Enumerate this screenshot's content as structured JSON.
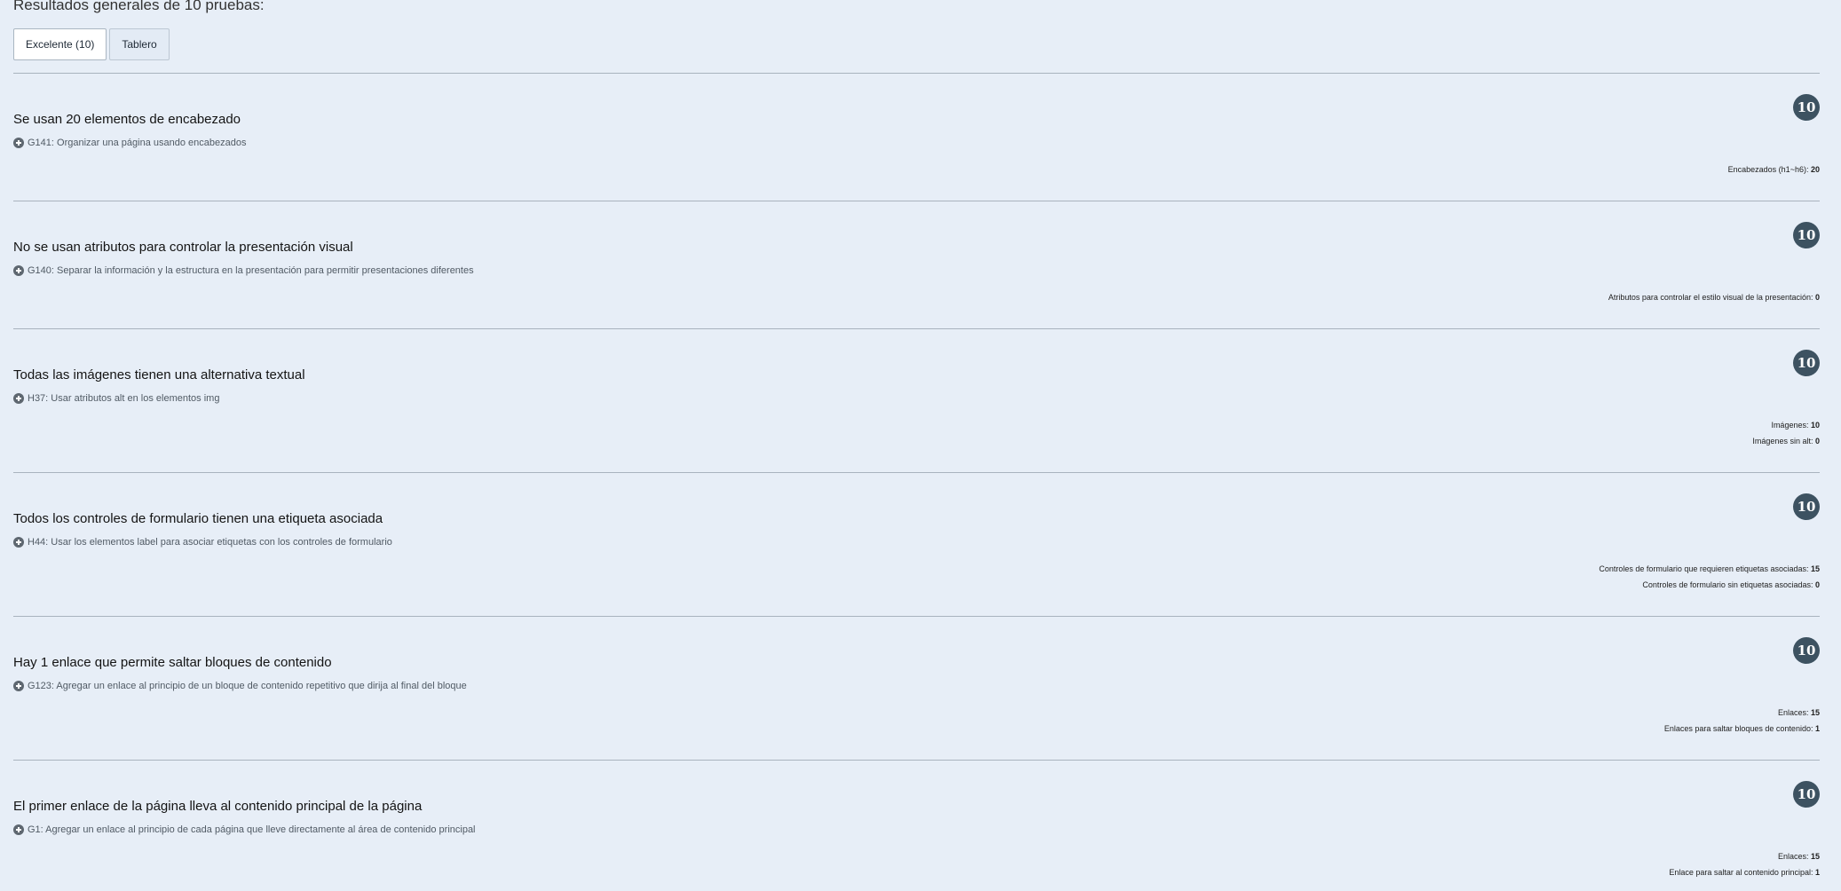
{
  "heading": "Resultados generales de 10 pruebas:",
  "tabs": [
    {
      "label": "Excelente (10)",
      "active": true
    },
    {
      "label": "Tablero",
      "active": false
    }
  ],
  "tests": [
    {
      "title": "Se usan 20 elementos de encabezado",
      "technique": "G141: Organizar una página usando encabezados",
      "score": "10",
      "metrics": [
        {
          "label": "Encabezados (h1~h6):",
          "value": "20"
        }
      ]
    },
    {
      "title": "No se usan atributos para controlar la presentación visual",
      "technique": "G140: Separar la información y la estructura en la presentación para permitir presentaciones diferentes",
      "score": "10",
      "metrics": [
        {
          "label": "Atributos para controlar el estilo visual de la presentación:",
          "value": "0"
        }
      ]
    },
    {
      "title": "Todas las imágenes tienen una alternativa textual",
      "technique": "H37: Usar atributos alt en los elementos img",
      "score": "10",
      "metrics": [
        {
          "label": "Imágenes:",
          "value": "10"
        },
        {
          "label": "Imágenes sin alt:",
          "value": "0"
        }
      ]
    },
    {
      "title": "Todos los controles de formulario tienen una etiqueta asociada",
      "technique": "H44: Usar los elementos label para asociar etiquetas con los controles de formulario",
      "score": "10",
      "metrics": [
        {
          "label": "Controles de formulario que requieren etiquetas asociadas:",
          "value": "15"
        },
        {
          "label": "Controles de formulario sin etiquetas asociadas:",
          "value": "0"
        }
      ]
    },
    {
      "title": "Hay 1 enlace que permite saltar bloques de contenido",
      "technique": "G123: Agregar un enlace al principio de un bloque de contenido repetitivo que dirija al final del bloque",
      "score": "10",
      "metrics": [
        {
          "label": "Enlaces:",
          "value": "15"
        },
        {
          "label": "Enlaces para saltar bloques de contenido:",
          "value": "1"
        }
      ]
    },
    {
      "title": "El primer enlace de la página lleva al contenido principal de la página",
      "technique": "G1: Agregar un enlace al principio de cada página que lleve directamente al área de contenido principal",
      "score": "10",
      "metrics": [
        {
          "label": "Enlaces:",
          "value": "15"
        },
        {
          "label": "Enlace para saltar al contenido principal:",
          "value": "1"
        }
      ]
    }
  ]
}
